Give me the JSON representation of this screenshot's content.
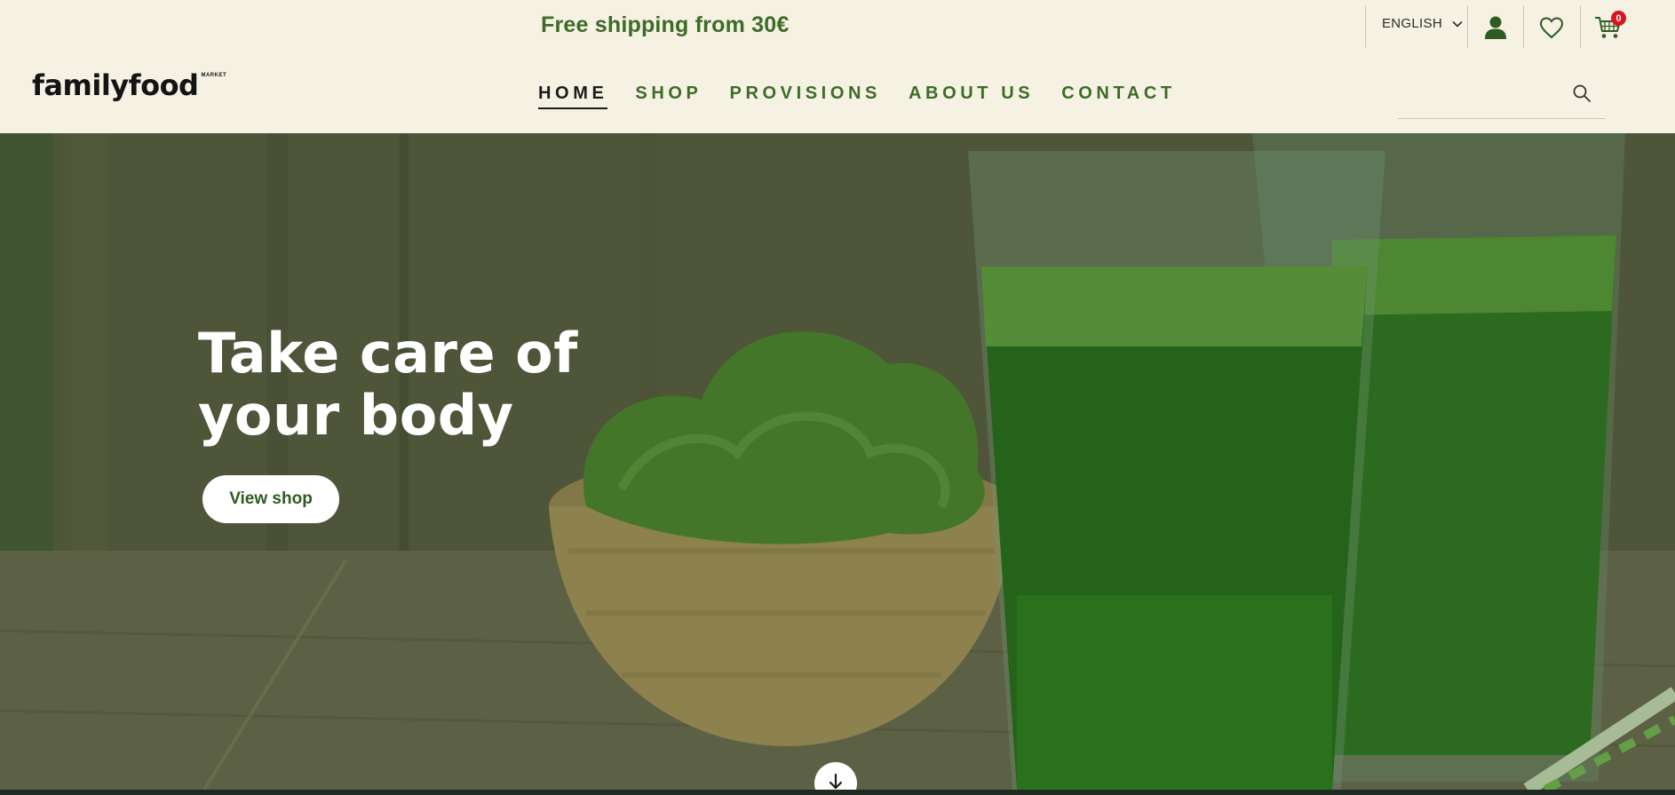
{
  "promo": {
    "text": "Free shipping from 30€"
  },
  "language": {
    "label": "ENGLISH"
  },
  "cart": {
    "count": "0"
  },
  "logo": {
    "name": "familyfood",
    "tag": "MARKET"
  },
  "nav": {
    "items": [
      {
        "label": "HOME",
        "active": true
      },
      {
        "label": "SHOP"
      },
      {
        "label": "PROVISIONS"
      },
      {
        "label": "ABOUT US"
      },
      {
        "label": "CONTACT"
      }
    ]
  },
  "search": {
    "placeholder": ""
  },
  "hero": {
    "title_line1": "Take care of",
    "title_line2": "your body",
    "cta_label": "View shop"
  },
  "colors": {
    "brand_green": "#3e6b28",
    "background": "#f5f1e3",
    "badge_red": "#d8141d"
  },
  "icons": [
    "chevron-down-icon",
    "user-icon",
    "heart-icon",
    "cart-icon",
    "search-icon",
    "arrow-down-icon"
  ]
}
